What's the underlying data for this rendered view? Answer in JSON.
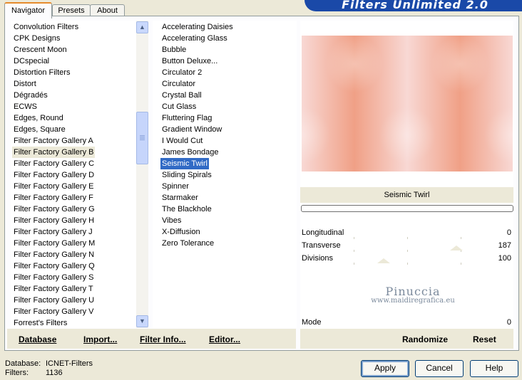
{
  "tabs": [
    "Navigator",
    "Presets",
    "About"
  ],
  "banner_title": "Filters Unlimited 2.0",
  "categories": [
    "Convolution Filters",
    "CPK Designs",
    "Crescent Moon",
    "DCspecial",
    "Distortion Filters",
    "Distort",
    "Dégradés",
    "ECWS",
    "Edges, Round",
    "Edges, Square",
    "Filter Factory Gallery A",
    "Filter Factory Gallery B",
    "Filter Factory Gallery C",
    "Filter Factory Gallery D",
    "Filter Factory Gallery E",
    "Filter Factory Gallery F",
    "Filter Factory Gallery G",
    "Filter Factory Gallery H",
    "Filter Factory Gallery J",
    "Filter Factory Gallery M",
    "Filter Factory Gallery N",
    "Filter Factory Gallery Q",
    "Filter Factory Gallery S",
    "Filter Factory Gallery T",
    "Filter Factory Gallery U",
    "Filter Factory Gallery V",
    "Forrest's Filters"
  ],
  "selected_category": "Filter Factory Gallery B",
  "filters": [
    "Accelerating Daisies",
    "Accelerating Glass",
    "Bubble",
    "Button Deluxe...",
    "Circulator 2",
    "Circulator",
    "Crystal Ball",
    "Cut Glass",
    "Fluttering Flag",
    "Gradient Window",
    "I Would Cut",
    "James Bondage",
    "Seismic Twirl",
    "Sliding Spirals",
    "Spinner",
    "Starmaker",
    "The Blackhole",
    "Vibes",
    "X-Diffusion",
    "Zero Tolerance"
  ],
  "selected_filter": "Seismic Twirl",
  "preview_caption": "Seismic Twirl",
  "params": [
    {
      "label": "Longitudinal",
      "value": "0"
    },
    {
      "label": "Transverse",
      "value": "187"
    },
    {
      "label": "Divisions",
      "value": "100"
    }
  ],
  "mode": {
    "label": "Mode",
    "value": "0"
  },
  "left_buttons": [
    "Database",
    "Import...",
    "Filter Info...",
    "Editor..."
  ],
  "right_buttons": [
    "Randomize",
    "Reset"
  ],
  "status": {
    "database_label": "Database:",
    "database_value": "ICNET-Filters",
    "filters_label": "Filters:",
    "filters_value": "1136"
  },
  "dialog_buttons": {
    "apply": "Apply",
    "cancel": "Cancel",
    "help": "Help"
  },
  "watermark": {
    "line1": "Pinuccia",
    "line2": "www.maidiregrafica.eu"
  },
  "colors": {
    "accent": "#316ac5",
    "preview_peach": "#f0a086",
    "preview_light": "#f8d8d4"
  }
}
